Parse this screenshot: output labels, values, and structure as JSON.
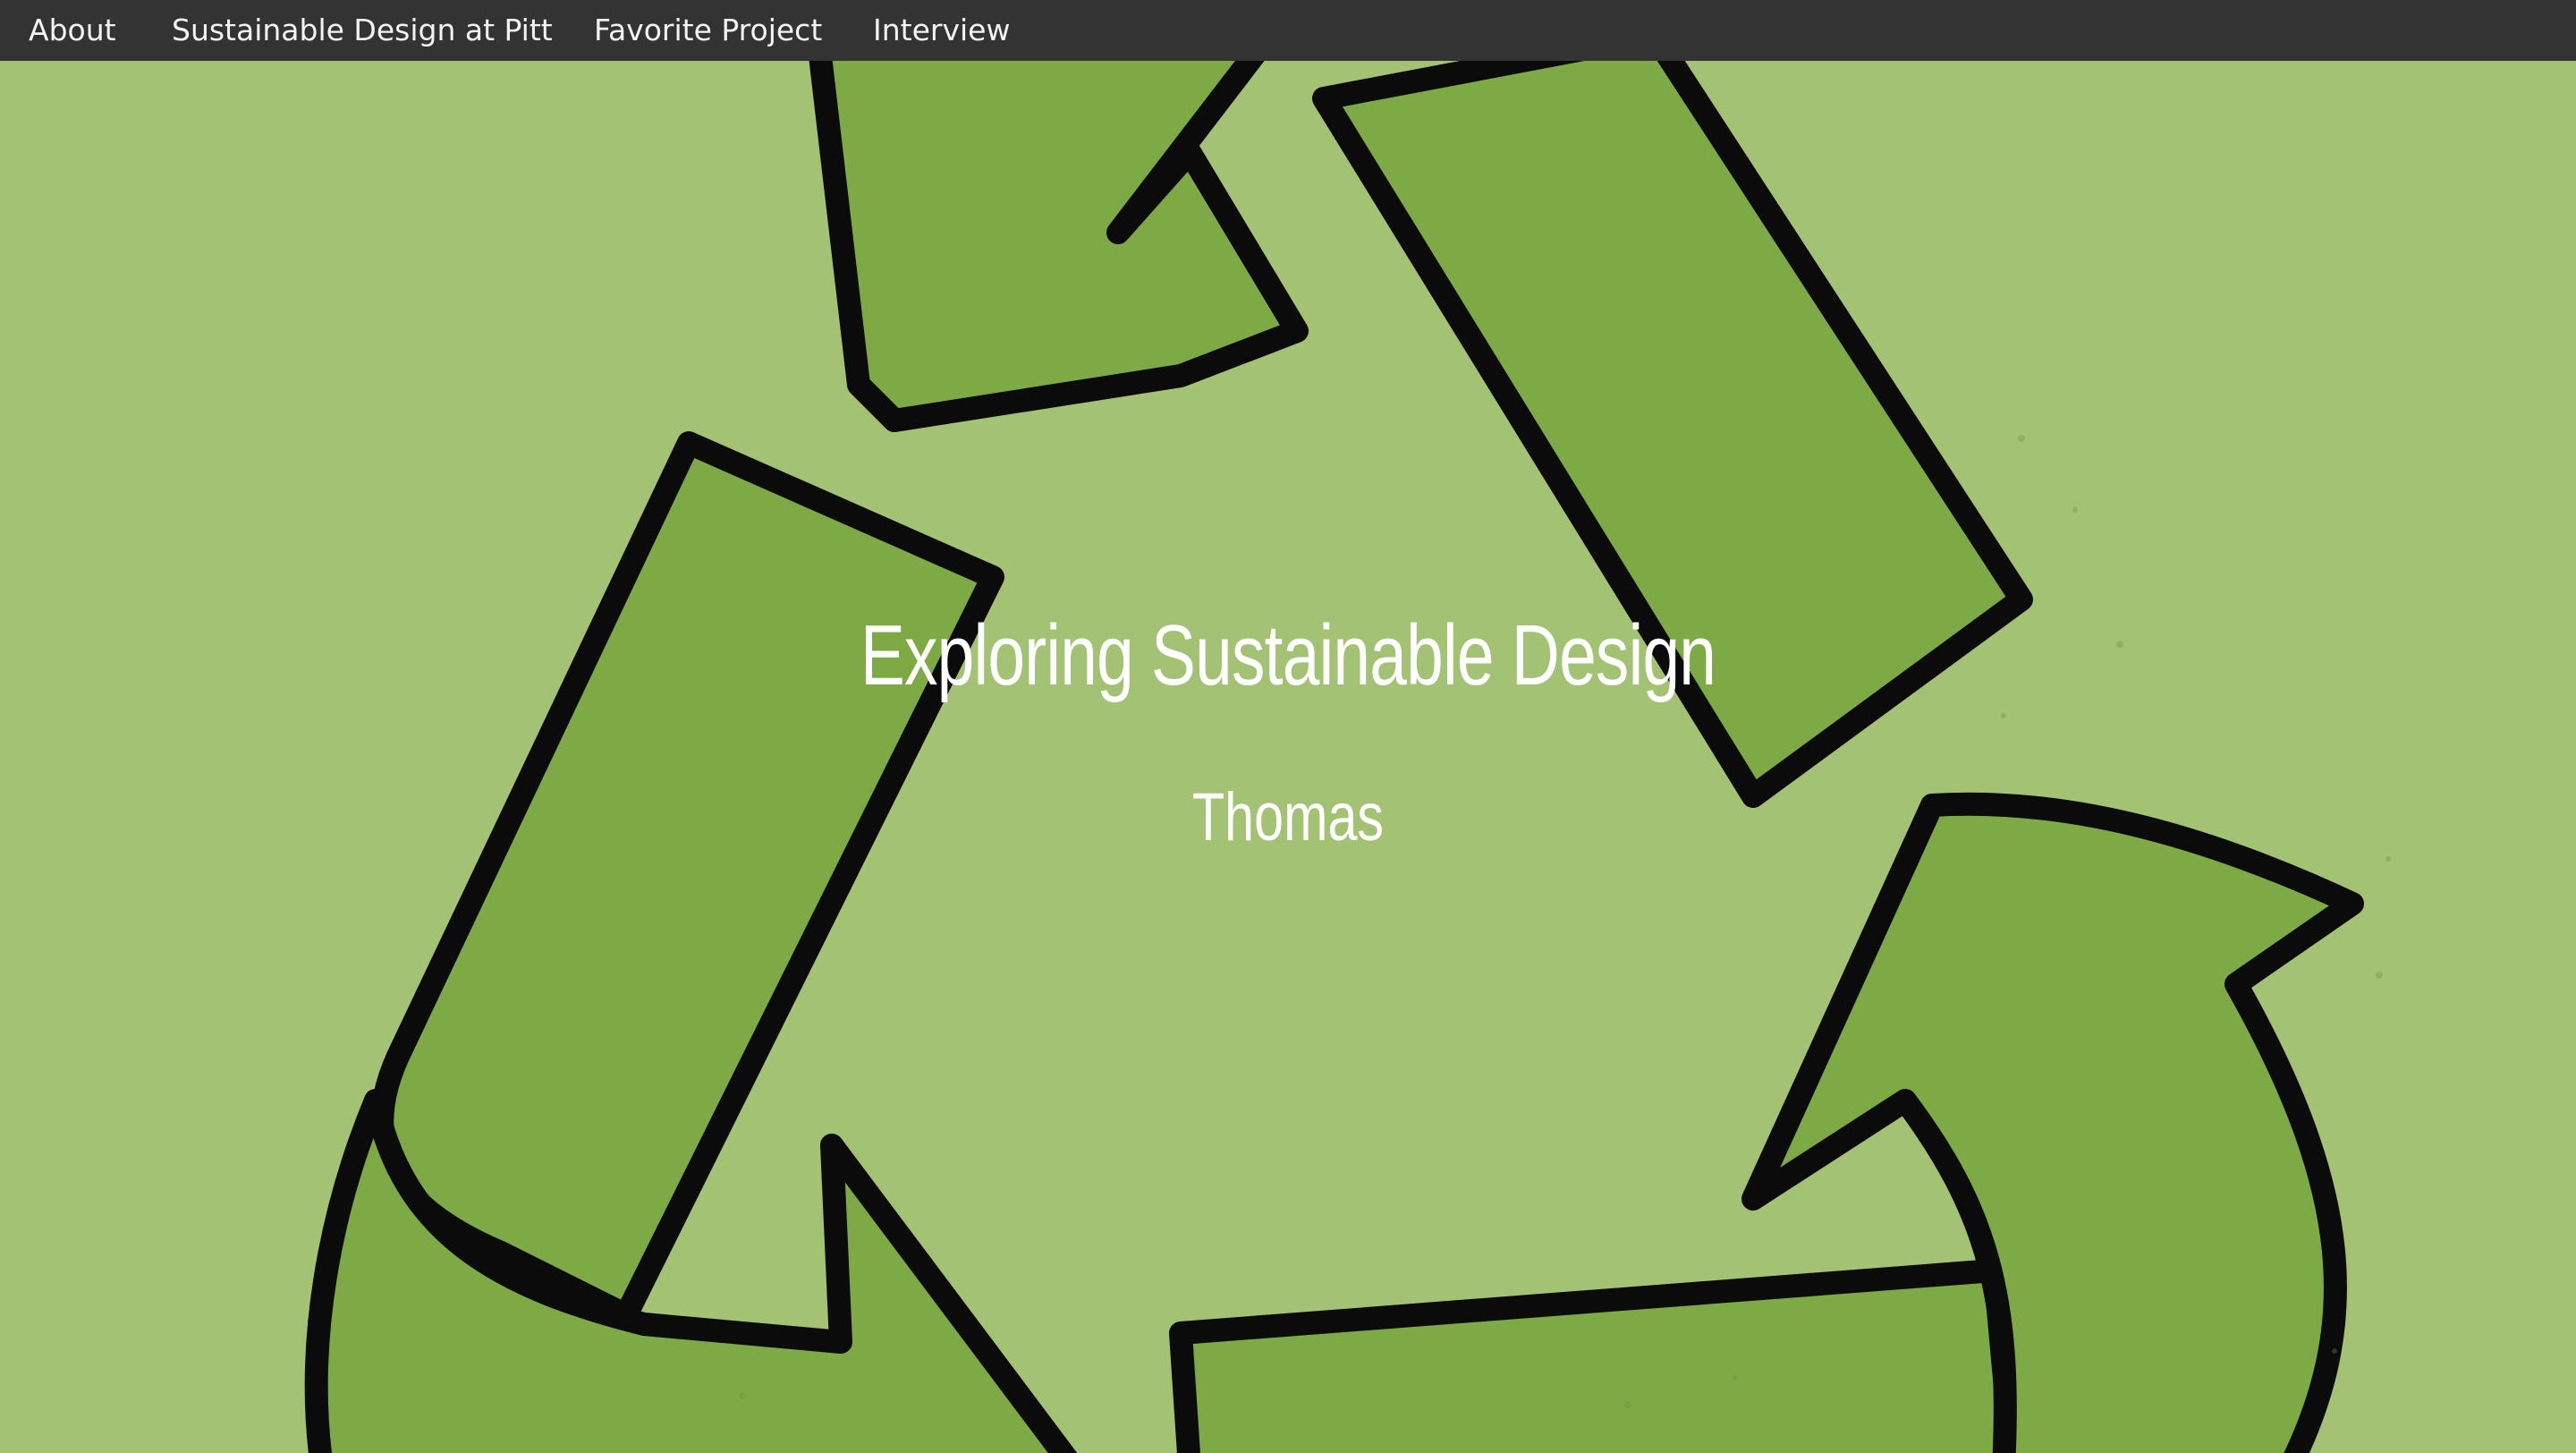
{
  "nav": {
    "items": [
      {
        "label": "About"
      },
      {
        "label": "Sustainable Design at Pitt"
      },
      {
        "label": "Favorite Project"
      },
      {
        "label": "Interview"
      }
    ]
  },
  "hero": {
    "title": "Exploring Sustainable Design",
    "subtitle": "Thomas",
    "background_image": "recycle-symbol"
  },
  "colors": {
    "nav_background": "#333333",
    "nav_text": "#f3f3f3",
    "background_green": "#a3c273",
    "arrow_green": "#7eaa45",
    "outline": "#0b0b0b",
    "heading_text": "#ffffff"
  }
}
